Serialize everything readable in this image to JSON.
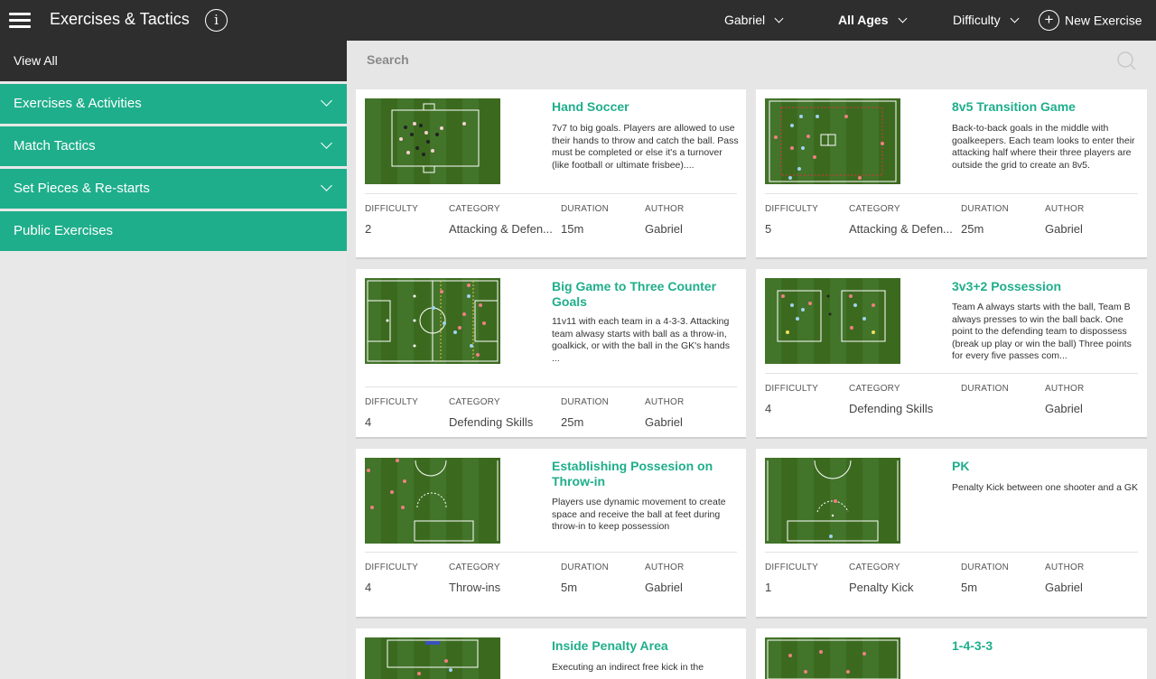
{
  "header": {
    "title": "Exercises & Tactics",
    "info_icon": "i",
    "user_filter": "Gabriel",
    "age_filter": "All Ages",
    "difficulty_filter": "Difficulty",
    "new_exercise_label": "New Exercise",
    "plus_icon": "+"
  },
  "sidebar": {
    "view_all": "View All",
    "items": [
      {
        "label": "Exercises & Activities"
      },
      {
        "label": "Match Tactics"
      },
      {
        "label": "Set Pieces & Re-starts"
      },
      {
        "label": "Public Exercises"
      }
    ]
  },
  "search": {
    "placeholder": "Search"
  },
  "meta_headers": {
    "difficulty": "DIFFICULTY",
    "category": "CATEGORY",
    "duration": "DURATION",
    "author": "AUTHOR"
  },
  "cards": [
    {
      "title": "Hand Soccer",
      "description": "7v7 to big goals. Players are allowed to use their hands to throw and catch the ball. Pass must be completed or else it's a turnover (like football or ultimate frisbee)....",
      "difficulty": "2",
      "category": "Attacking & Defen...",
      "duration": "15m",
      "author": "Gabriel"
    },
    {
      "title": "8v5 Transition Game",
      "description": "Back-to-back goals in the middle with goalkeepers. Each team looks to enter their attacking half where their three players are outside the grid to create an 8v5.",
      "difficulty": "5",
      "category": "Attacking & Defen...",
      "duration": "25m",
      "author": "Gabriel"
    },
    {
      "title": "Big Game to Three Counter Goals",
      "description": "11v11 with each team in a 4-3-3. Attacking team alwasy starts with ball as a throw-in, goalkick, or with the ball in the GK's hands\n...",
      "difficulty": "4",
      "category": "Defending Skills",
      "duration": "25m",
      "author": "Gabriel"
    },
    {
      "title": "3v3+2 Possession",
      "description": "Team A always starts with the ball, Team B always presses to win the ball back. One point to the defending team to dispossess (break up play or win the ball) Three points for every five passes com...",
      "difficulty": "4",
      "category": "Defending Skills",
      "duration": "",
      "author": "Gabriel"
    },
    {
      "title": "Establishing Possesion on Throw-in",
      "description": "Players use dynamic movement to create space and receive the ball at feet during throw-in to keep possession",
      "difficulty": "4",
      "category": "Throw-ins",
      "duration": "5m",
      "author": "Gabriel"
    },
    {
      "title": "PK",
      "description": "Penalty Kick between one shooter and a GK",
      "difficulty": "1",
      "category": "Penalty Kick",
      "duration": "5m",
      "author": "Gabriel"
    },
    {
      "title": "Inside Penalty Area",
      "description": "Executing an indirect free kick in the",
      "difficulty": "",
      "category": "",
      "duration": "",
      "author": ""
    },
    {
      "title": "1-4-3-3",
      "description": "",
      "difficulty": "",
      "category": "",
      "duration": "",
      "author": ""
    }
  ],
  "colors": {
    "accent": "#1fae8b",
    "topbar": "#2e2e2e",
    "pitch": "#3b6a1f"
  }
}
